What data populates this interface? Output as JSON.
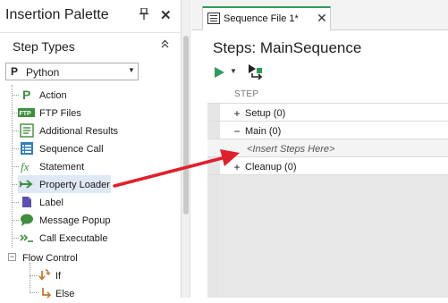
{
  "palette": {
    "title": "Insertion Palette",
    "pin_glyph": "📌",
    "close_glyph": "✕",
    "step_types_label": "Step Types",
    "collapse_glyph": "»",
    "language": {
      "letter": "P",
      "value": "Python",
      "arrow": "▼"
    },
    "items": [
      {
        "label": "Action",
        "icon": "action-p-icon"
      },
      {
        "label": "FTP Files",
        "icon": "ftp-icon"
      },
      {
        "label": "Additional Results",
        "icon": "additional-results-icon"
      },
      {
        "label": "Sequence Call",
        "icon": "sequence-call-icon"
      },
      {
        "label": "Statement",
        "icon": "statement-fx-icon"
      },
      {
        "label": "Property Loader",
        "icon": "property-loader-icon"
      },
      {
        "label": "Label",
        "icon": "label-icon"
      },
      {
        "label": "Message Popup",
        "icon": "message-popup-icon"
      },
      {
        "label": "Call Executable",
        "icon": "call-executable-icon"
      }
    ],
    "flow_control": {
      "label": "Flow Control",
      "expander": "−",
      "children": [
        {
          "label": "If",
          "icon": "if-icon"
        },
        {
          "label": "Else",
          "icon": "else-icon"
        }
      ]
    }
  },
  "document": {
    "tab_label": "Sequence File 1*",
    "tab_close": "✕",
    "steps_title": "Steps: MainSequence",
    "run_dropdown_glyph": "▼",
    "column_header": "STEP",
    "rows": [
      {
        "sign": "+",
        "label": "Setup (0)"
      },
      {
        "sign": "−",
        "label": "Main (0)"
      },
      {
        "sign": "",
        "label": "<Insert Steps Here>"
      },
      {
        "sign": "+",
        "label": "Cleanup (0)"
      }
    ]
  },
  "colors": {
    "accent_green": "#2e9c59",
    "annotation_arrow": "#e0202a",
    "selection": "#dfe8f5"
  }
}
